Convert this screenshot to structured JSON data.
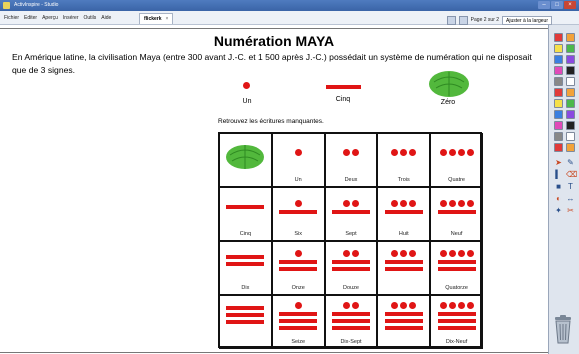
{
  "window": {
    "title": "ActivInspire - Studio",
    "controls": [
      "–",
      "□",
      "×"
    ]
  },
  "menubar": {
    "items": [
      "Fichier",
      "Editer",
      "Aperçu",
      "Insérer",
      "Outils",
      "Aide"
    ],
    "tab_label": "flickerk",
    "page_info": "Page 2 sur 2",
    "fit_label": "Ajuster à la largeur"
  },
  "page": {
    "title": "Numération MAYA",
    "intro": "En Amérique latine, la civilisation Maya (entre 300 avant J.-C. et 1 500 après J.-C.) possédait un système de numération qui ne disposait que de 3 signes.",
    "legend": {
      "one": "Un",
      "five": "Cinq",
      "zero": "Zéro"
    },
    "subtitle": "Retrouvez les écritures manquantes.",
    "colors": {
      "glyph_red": "#e01515",
      "shell_green": "#52b83c"
    },
    "grid": [
      {
        "value": 0,
        "label": ""
      },
      {
        "value": 1,
        "label": "Un"
      },
      {
        "value": 2,
        "label": "Deux"
      },
      {
        "value": 3,
        "label": "Trois"
      },
      {
        "value": 4,
        "label": "Quatre"
      },
      {
        "value": 5,
        "label": "Cinq"
      },
      {
        "value": 6,
        "label": "Six"
      },
      {
        "value": 7,
        "label": "Sept"
      },
      {
        "value": 8,
        "label": "Huit"
      },
      {
        "value": 9,
        "label": "Neuf"
      },
      {
        "value": 10,
        "label": "Dix"
      },
      {
        "value": 11,
        "label": "Onze"
      },
      {
        "value": 12,
        "label": "Douze"
      },
      {
        "value": 13,
        "label": ""
      },
      {
        "value": 14,
        "label": "Quatorze"
      },
      {
        "value": 15,
        "label": ""
      },
      {
        "value": 16,
        "label": "Seize"
      },
      {
        "value": 17,
        "label": "Dix-Sept"
      },
      {
        "value": 18,
        "label": ""
      },
      {
        "value": 19,
        "label": "Dix-Neuf"
      }
    ]
  },
  "toolbar": {
    "icons": [
      "select-icon",
      "pen-icon",
      "highlighter-icon",
      "eraser-icon",
      "shape-icon",
      "text-icon",
      "fill-icon",
      "connector-icon",
      "magic-ink-icon",
      "clear-icon"
    ]
  }
}
